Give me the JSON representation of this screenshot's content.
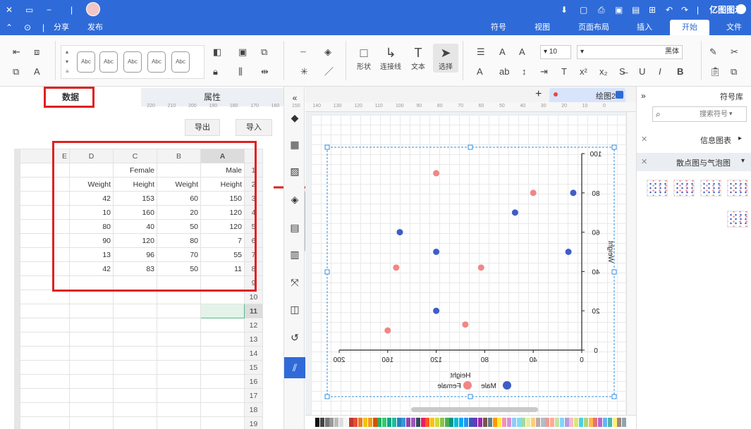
{
  "titlebar": {
    "app_name": "亿图图示",
    "items": [
      "文件",
      "开始",
      "插入",
      "页面布局",
      "视图",
      "符号",
      "发布",
      "分享"
    ]
  },
  "menubar": {
    "tabs": [
      "文件",
      "开始",
      "插入",
      "页面布局",
      "视图",
      "符号"
    ],
    "active": "开始",
    "publish": "发布",
    "share": "分享"
  },
  "ribbon": {
    "groups": {
      "select_label": "选择",
      "text_label": "文本",
      "connector_label": "连接线",
      "shape_label": "形状"
    },
    "font_name": "黑体",
    "font_size": "10",
    "style_samples": [
      "Abc",
      "Abc",
      "Abc",
      "Abc",
      "Abc",
      "Abc"
    ]
  },
  "left_panel": {
    "tabs": {
      "data": "数据",
      "properties": "属性"
    },
    "import_button": "导入",
    "export_button": "导出",
    "columns": [
      "A",
      "B",
      "C",
      "D",
      "E"
    ],
    "rows": [
      {
        "n": "1",
        "cells": [
          "Male",
          "",
          "Female",
          "",
          ""
        ]
      },
      {
        "n": "2",
        "cells": [
          "Height",
          "Weight",
          "Height",
          "Weight",
          ""
        ]
      },
      {
        "n": "3",
        "cells": [
          "150",
          "60",
          "153",
          "42",
          ""
        ]
      },
      {
        "n": "4",
        "cells": [
          "120",
          "20",
          "160",
          "10",
          ""
        ]
      },
      {
        "n": "5",
        "cells": [
          "120",
          "50",
          "40",
          "80",
          ""
        ]
      },
      {
        "n": "6",
        "cells": [
          "7",
          "80",
          "120",
          "90",
          ""
        ]
      },
      {
        "n": "7",
        "cells": [
          "55",
          "70",
          "96",
          "13",
          ""
        ]
      },
      {
        "n": "8",
        "cells": [
          "11",
          "50",
          "83",
          "42",
          ""
        ]
      },
      {
        "n": "9",
        "cells": [
          "",
          "",
          "",
          "",
          ""
        ]
      },
      {
        "n": "10",
        "cells": [
          "",
          "",
          "",
          "",
          ""
        ]
      },
      {
        "n": "11",
        "cells": [
          "",
          "",
          "",
          "",
          ""
        ]
      },
      {
        "n": "12",
        "cells": [
          "",
          "",
          "",
          "",
          ""
        ]
      },
      {
        "n": "13",
        "cells": [
          "",
          "",
          "",
          "",
          ""
        ]
      },
      {
        "n": "14",
        "cells": [
          "",
          "",
          "",
          "",
          ""
        ]
      },
      {
        "n": "15",
        "cells": [
          "",
          "",
          "",
          "",
          ""
        ]
      },
      {
        "n": "16",
        "cells": [
          "",
          "",
          "",
          "",
          ""
        ]
      },
      {
        "n": "17",
        "cells": [
          "",
          "",
          "",
          "",
          ""
        ]
      },
      {
        "n": "18",
        "cells": [
          "",
          "",
          "",
          "",
          ""
        ]
      },
      {
        "n": "19",
        "cells": [
          "",
          "",
          "",
          "",
          ""
        ]
      }
    ]
  },
  "canvas": {
    "doc_tab": "绘图2",
    "ruler_labels": [
      "0",
      "10",
      "20",
      "30",
      "40",
      "50",
      "60",
      "70",
      "80",
      "90",
      "100",
      "110",
      "120",
      "130",
      "140",
      "150",
      "160",
      "170",
      "180",
      "190",
      "200",
      "210",
      "220"
    ]
  },
  "right_panel": {
    "title": "符号库",
    "search_placeholder": "搜索符号",
    "category_info": "信息图表",
    "category_scatter": "散点图与气泡图"
  },
  "colors": {
    "brand": "#2f6bd8",
    "male": "#3f5dc7",
    "female": "#f08787",
    "annotation": "#e02020"
  },
  "chart_data": {
    "type": "scatter",
    "xlabel": "Height",
    "ylabel": "Weight",
    "xlim": [
      0,
      200
    ],
    "ylim": [
      0,
      100
    ],
    "x_ticks": [
      0,
      40,
      80,
      120,
      160,
      200
    ],
    "y_ticks": [
      0,
      20,
      40,
      60,
      80,
      100
    ],
    "mirrored": true,
    "series": [
      {
        "name": "Male",
        "color": "#3f5dc7",
        "points": [
          [
            150,
            60
          ],
          [
            120,
            20
          ],
          [
            120,
            50
          ],
          [
            7,
            80
          ],
          [
            55,
            70
          ],
          [
            11,
            50
          ]
        ]
      },
      {
        "name": "Female",
        "color": "#f08787",
        "points": [
          [
            153,
            42
          ],
          [
            160,
            10
          ],
          [
            40,
            80
          ],
          [
            120,
            90
          ],
          [
            96,
            13
          ],
          [
            83,
            42
          ]
        ]
      }
    ]
  }
}
